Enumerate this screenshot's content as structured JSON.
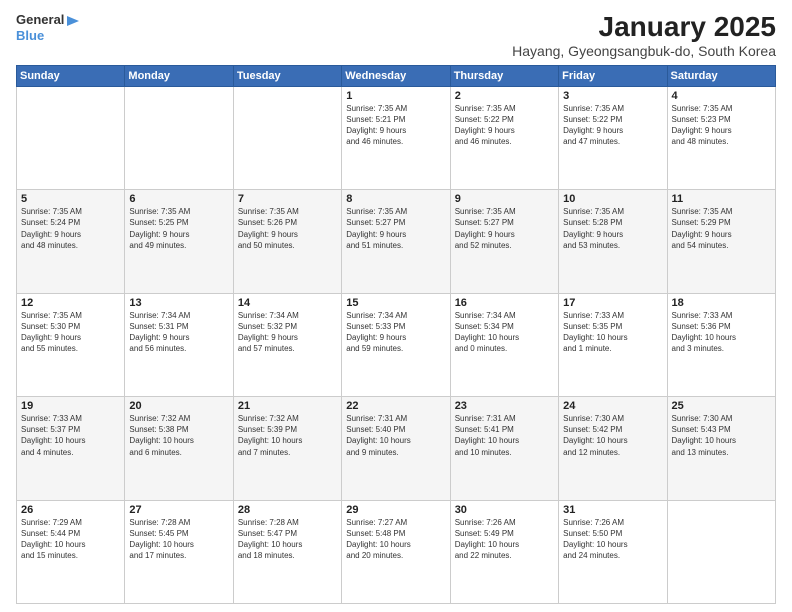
{
  "logo": {
    "general": "General",
    "blue": "Blue"
  },
  "header": {
    "title": "January 2025",
    "subtitle": "Hayang, Gyeongsangbuk-do, South Korea"
  },
  "weekdays": [
    "Sunday",
    "Monday",
    "Tuesday",
    "Wednesday",
    "Thursday",
    "Friday",
    "Saturday"
  ],
  "weeks": [
    [
      {
        "day": "",
        "info": ""
      },
      {
        "day": "",
        "info": ""
      },
      {
        "day": "",
        "info": ""
      },
      {
        "day": "1",
        "info": "Sunrise: 7:35 AM\nSunset: 5:21 PM\nDaylight: 9 hours\nand 46 minutes."
      },
      {
        "day": "2",
        "info": "Sunrise: 7:35 AM\nSunset: 5:22 PM\nDaylight: 9 hours\nand 46 minutes."
      },
      {
        "day": "3",
        "info": "Sunrise: 7:35 AM\nSunset: 5:22 PM\nDaylight: 9 hours\nand 47 minutes."
      },
      {
        "day": "4",
        "info": "Sunrise: 7:35 AM\nSunset: 5:23 PM\nDaylight: 9 hours\nand 48 minutes."
      }
    ],
    [
      {
        "day": "5",
        "info": "Sunrise: 7:35 AM\nSunset: 5:24 PM\nDaylight: 9 hours\nand 48 minutes."
      },
      {
        "day": "6",
        "info": "Sunrise: 7:35 AM\nSunset: 5:25 PM\nDaylight: 9 hours\nand 49 minutes."
      },
      {
        "day": "7",
        "info": "Sunrise: 7:35 AM\nSunset: 5:26 PM\nDaylight: 9 hours\nand 50 minutes."
      },
      {
        "day": "8",
        "info": "Sunrise: 7:35 AM\nSunset: 5:27 PM\nDaylight: 9 hours\nand 51 minutes."
      },
      {
        "day": "9",
        "info": "Sunrise: 7:35 AM\nSunset: 5:27 PM\nDaylight: 9 hours\nand 52 minutes."
      },
      {
        "day": "10",
        "info": "Sunrise: 7:35 AM\nSunset: 5:28 PM\nDaylight: 9 hours\nand 53 minutes."
      },
      {
        "day": "11",
        "info": "Sunrise: 7:35 AM\nSunset: 5:29 PM\nDaylight: 9 hours\nand 54 minutes."
      }
    ],
    [
      {
        "day": "12",
        "info": "Sunrise: 7:35 AM\nSunset: 5:30 PM\nDaylight: 9 hours\nand 55 minutes."
      },
      {
        "day": "13",
        "info": "Sunrise: 7:34 AM\nSunset: 5:31 PM\nDaylight: 9 hours\nand 56 minutes."
      },
      {
        "day": "14",
        "info": "Sunrise: 7:34 AM\nSunset: 5:32 PM\nDaylight: 9 hours\nand 57 minutes."
      },
      {
        "day": "15",
        "info": "Sunrise: 7:34 AM\nSunset: 5:33 PM\nDaylight: 9 hours\nand 59 minutes."
      },
      {
        "day": "16",
        "info": "Sunrise: 7:34 AM\nSunset: 5:34 PM\nDaylight: 10 hours\nand 0 minutes."
      },
      {
        "day": "17",
        "info": "Sunrise: 7:33 AM\nSunset: 5:35 PM\nDaylight: 10 hours\nand 1 minute."
      },
      {
        "day": "18",
        "info": "Sunrise: 7:33 AM\nSunset: 5:36 PM\nDaylight: 10 hours\nand 3 minutes."
      }
    ],
    [
      {
        "day": "19",
        "info": "Sunrise: 7:33 AM\nSunset: 5:37 PM\nDaylight: 10 hours\nand 4 minutes."
      },
      {
        "day": "20",
        "info": "Sunrise: 7:32 AM\nSunset: 5:38 PM\nDaylight: 10 hours\nand 6 minutes."
      },
      {
        "day": "21",
        "info": "Sunrise: 7:32 AM\nSunset: 5:39 PM\nDaylight: 10 hours\nand 7 minutes."
      },
      {
        "day": "22",
        "info": "Sunrise: 7:31 AM\nSunset: 5:40 PM\nDaylight: 10 hours\nand 9 minutes."
      },
      {
        "day": "23",
        "info": "Sunrise: 7:31 AM\nSunset: 5:41 PM\nDaylight: 10 hours\nand 10 minutes."
      },
      {
        "day": "24",
        "info": "Sunrise: 7:30 AM\nSunset: 5:42 PM\nDaylight: 10 hours\nand 12 minutes."
      },
      {
        "day": "25",
        "info": "Sunrise: 7:30 AM\nSunset: 5:43 PM\nDaylight: 10 hours\nand 13 minutes."
      }
    ],
    [
      {
        "day": "26",
        "info": "Sunrise: 7:29 AM\nSunset: 5:44 PM\nDaylight: 10 hours\nand 15 minutes."
      },
      {
        "day": "27",
        "info": "Sunrise: 7:28 AM\nSunset: 5:45 PM\nDaylight: 10 hours\nand 17 minutes."
      },
      {
        "day": "28",
        "info": "Sunrise: 7:28 AM\nSunset: 5:47 PM\nDaylight: 10 hours\nand 18 minutes."
      },
      {
        "day": "29",
        "info": "Sunrise: 7:27 AM\nSunset: 5:48 PM\nDaylight: 10 hours\nand 20 minutes."
      },
      {
        "day": "30",
        "info": "Sunrise: 7:26 AM\nSunset: 5:49 PM\nDaylight: 10 hours\nand 22 minutes."
      },
      {
        "day": "31",
        "info": "Sunrise: 7:26 AM\nSunset: 5:50 PM\nDaylight: 10 hours\nand 24 minutes."
      },
      {
        "day": "",
        "info": ""
      }
    ]
  ]
}
